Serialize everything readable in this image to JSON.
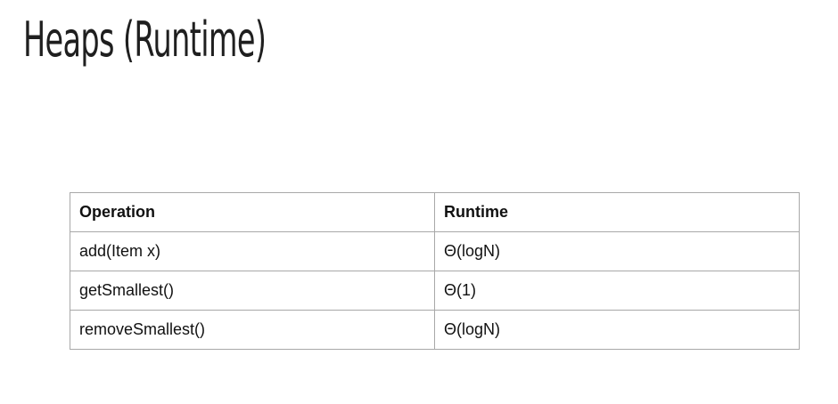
{
  "slide": {
    "title": "Heaps (Runtime)"
  },
  "table": {
    "headers": [
      "Operation",
      "Runtime"
    ],
    "rows": [
      [
        "add(Item x)",
        "Θ(logN)"
      ],
      [
        "getSmallest()",
        "Θ(1)"
      ],
      [
        "removeSmallest()",
        "Θ(logN)"
      ]
    ]
  }
}
